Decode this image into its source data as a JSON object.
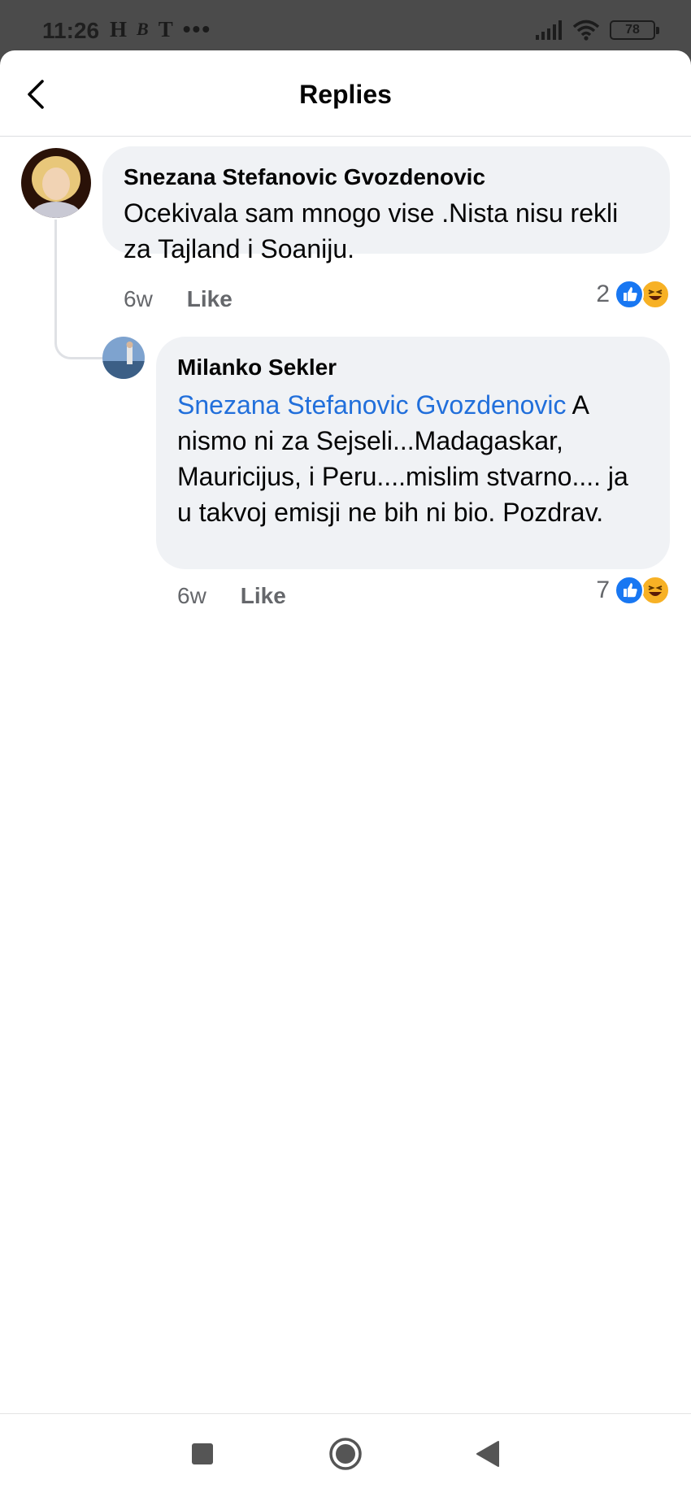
{
  "status_bar": {
    "time": "11:26",
    "app_icons": [
      "H",
      "B",
      "T"
    ],
    "more": "•••",
    "battery": "78"
  },
  "header": {
    "title": "Replies",
    "back_icon": "chevron-left-icon"
  },
  "comments": [
    {
      "author": "Snezana Stefanovic Gvozdenovic",
      "text": "Ocekivala sam mnogo vise .Nista nisu rekli za Tajland i Soaniju.",
      "time": "6w",
      "like_label": "Like",
      "reaction_count": "2",
      "reactions": [
        "like-icon",
        "haha-icon"
      ]
    },
    {
      "author": "Milanko Sekler",
      "mention": "Snezana Stefanovic Gvozdenovic",
      "text": " A nismo ni za Sejseli...Madagaskar, Mauricijus, i Peru....mislim stvarno.... ja u takvoj emisji ne bih ni bio. Pozdrav.",
      "time": "6w",
      "like_label": "Like",
      "reaction_count": "7",
      "reactions": [
        "like-icon",
        "haha-icon"
      ]
    }
  ],
  "nav_bar": {
    "buttons": [
      "recents-square-icon",
      "home-circle-icon",
      "back-triangle-icon"
    ]
  },
  "colors": {
    "bubble": "#f0f2f5",
    "mention": "#216fdb",
    "like_blue": "#1877f2",
    "haha_yellow": "#f7b125",
    "meta_gray": "#65676b"
  }
}
